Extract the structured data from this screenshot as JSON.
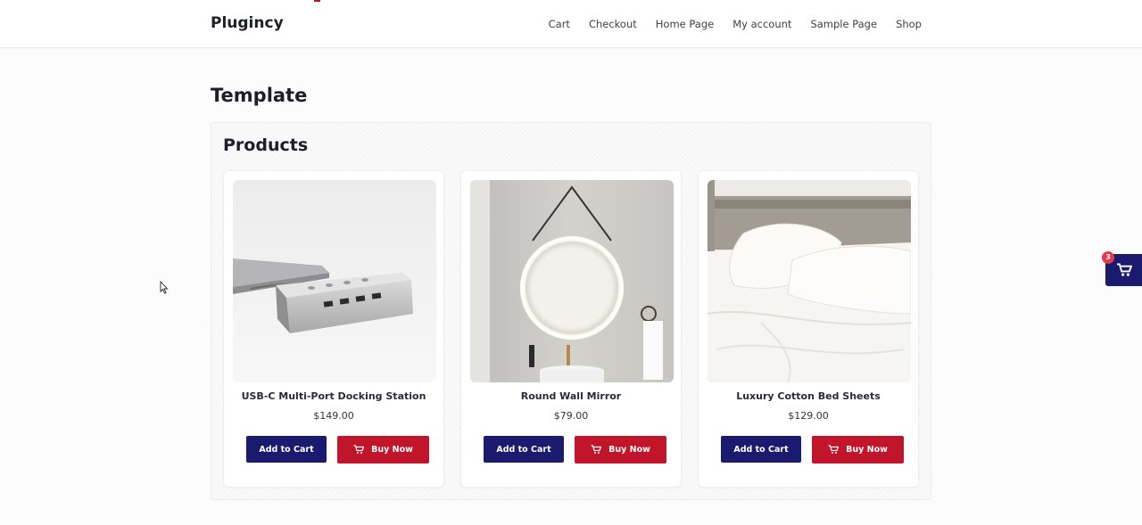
{
  "header": {
    "brand": "Plugincy",
    "nav": [
      "Cart",
      "Checkout",
      "Home Page",
      "My account",
      "Sample Page",
      "Shop"
    ]
  },
  "page": {
    "title": "Template"
  },
  "products_section": {
    "title": "Products",
    "items": [
      {
        "name": "USB-C Multi-Port Docking Station",
        "price": "$149.00",
        "add_label": "Add to Cart",
        "buy_label": "Buy Now"
      },
      {
        "name": "Round Wall Mirror",
        "price": "$79.00",
        "add_label": "Add to Cart",
        "buy_label": "Buy Now"
      },
      {
        "name": "Luxury Cotton Bed Sheets",
        "price": "$129.00",
        "add_label": "Add to Cart",
        "buy_label": "Buy Now"
      }
    ]
  },
  "floating_cart": {
    "count": "3",
    "icon": "cart-icon"
  },
  "colors": {
    "primary": "#1a1a6e",
    "accent": "#c0152a",
    "badge": "#e23a4a"
  }
}
